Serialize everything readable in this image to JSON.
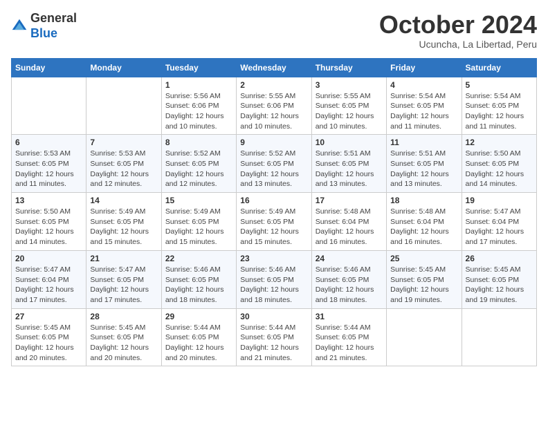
{
  "header": {
    "logo_general": "General",
    "logo_blue": "Blue",
    "month_title": "October 2024",
    "subtitle": "Ucuncha, La Libertad, Peru"
  },
  "weekdays": [
    "Sunday",
    "Monday",
    "Tuesday",
    "Wednesday",
    "Thursday",
    "Friday",
    "Saturday"
  ],
  "weeks": [
    [
      {
        "day": "",
        "info": ""
      },
      {
        "day": "",
        "info": ""
      },
      {
        "day": "1",
        "info": "Sunrise: 5:56 AM\nSunset: 6:06 PM\nDaylight: 12 hours and 10 minutes."
      },
      {
        "day": "2",
        "info": "Sunrise: 5:55 AM\nSunset: 6:06 PM\nDaylight: 12 hours and 10 minutes."
      },
      {
        "day": "3",
        "info": "Sunrise: 5:55 AM\nSunset: 6:05 PM\nDaylight: 12 hours and 10 minutes."
      },
      {
        "day": "4",
        "info": "Sunrise: 5:54 AM\nSunset: 6:05 PM\nDaylight: 12 hours and 11 minutes."
      },
      {
        "day": "5",
        "info": "Sunrise: 5:54 AM\nSunset: 6:05 PM\nDaylight: 12 hours and 11 minutes."
      }
    ],
    [
      {
        "day": "6",
        "info": "Sunrise: 5:53 AM\nSunset: 6:05 PM\nDaylight: 12 hours and 11 minutes."
      },
      {
        "day": "7",
        "info": "Sunrise: 5:53 AM\nSunset: 6:05 PM\nDaylight: 12 hours and 12 minutes."
      },
      {
        "day": "8",
        "info": "Sunrise: 5:52 AM\nSunset: 6:05 PM\nDaylight: 12 hours and 12 minutes."
      },
      {
        "day": "9",
        "info": "Sunrise: 5:52 AM\nSunset: 6:05 PM\nDaylight: 12 hours and 13 minutes."
      },
      {
        "day": "10",
        "info": "Sunrise: 5:51 AM\nSunset: 6:05 PM\nDaylight: 12 hours and 13 minutes."
      },
      {
        "day": "11",
        "info": "Sunrise: 5:51 AM\nSunset: 6:05 PM\nDaylight: 12 hours and 13 minutes."
      },
      {
        "day": "12",
        "info": "Sunrise: 5:50 AM\nSunset: 6:05 PM\nDaylight: 12 hours and 14 minutes."
      }
    ],
    [
      {
        "day": "13",
        "info": "Sunrise: 5:50 AM\nSunset: 6:05 PM\nDaylight: 12 hours and 14 minutes."
      },
      {
        "day": "14",
        "info": "Sunrise: 5:49 AM\nSunset: 6:05 PM\nDaylight: 12 hours and 15 minutes."
      },
      {
        "day": "15",
        "info": "Sunrise: 5:49 AM\nSunset: 6:05 PM\nDaylight: 12 hours and 15 minutes."
      },
      {
        "day": "16",
        "info": "Sunrise: 5:49 AM\nSunset: 6:05 PM\nDaylight: 12 hours and 15 minutes."
      },
      {
        "day": "17",
        "info": "Sunrise: 5:48 AM\nSunset: 6:04 PM\nDaylight: 12 hours and 16 minutes."
      },
      {
        "day": "18",
        "info": "Sunrise: 5:48 AM\nSunset: 6:04 PM\nDaylight: 12 hours and 16 minutes."
      },
      {
        "day": "19",
        "info": "Sunrise: 5:47 AM\nSunset: 6:04 PM\nDaylight: 12 hours and 17 minutes."
      }
    ],
    [
      {
        "day": "20",
        "info": "Sunrise: 5:47 AM\nSunset: 6:04 PM\nDaylight: 12 hours and 17 minutes."
      },
      {
        "day": "21",
        "info": "Sunrise: 5:47 AM\nSunset: 6:05 PM\nDaylight: 12 hours and 17 minutes."
      },
      {
        "day": "22",
        "info": "Sunrise: 5:46 AM\nSunset: 6:05 PM\nDaylight: 12 hours and 18 minutes."
      },
      {
        "day": "23",
        "info": "Sunrise: 5:46 AM\nSunset: 6:05 PM\nDaylight: 12 hours and 18 minutes."
      },
      {
        "day": "24",
        "info": "Sunrise: 5:46 AM\nSunset: 6:05 PM\nDaylight: 12 hours and 18 minutes."
      },
      {
        "day": "25",
        "info": "Sunrise: 5:45 AM\nSunset: 6:05 PM\nDaylight: 12 hours and 19 minutes."
      },
      {
        "day": "26",
        "info": "Sunrise: 5:45 AM\nSunset: 6:05 PM\nDaylight: 12 hours and 19 minutes."
      }
    ],
    [
      {
        "day": "27",
        "info": "Sunrise: 5:45 AM\nSunset: 6:05 PM\nDaylight: 12 hours and 20 minutes."
      },
      {
        "day": "28",
        "info": "Sunrise: 5:45 AM\nSunset: 6:05 PM\nDaylight: 12 hours and 20 minutes."
      },
      {
        "day": "29",
        "info": "Sunrise: 5:44 AM\nSunset: 6:05 PM\nDaylight: 12 hours and 20 minutes."
      },
      {
        "day": "30",
        "info": "Sunrise: 5:44 AM\nSunset: 6:05 PM\nDaylight: 12 hours and 21 minutes."
      },
      {
        "day": "31",
        "info": "Sunrise: 5:44 AM\nSunset: 6:05 PM\nDaylight: 12 hours and 21 minutes."
      },
      {
        "day": "",
        "info": ""
      },
      {
        "day": "",
        "info": ""
      }
    ]
  ]
}
